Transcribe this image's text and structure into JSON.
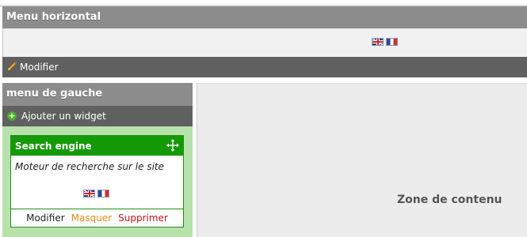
{
  "horizontal_menu": {
    "title": "Menu horizontal",
    "flags": [
      "english-flag-icon",
      "french-flag-icon"
    ],
    "edit_label": "Modifier"
  },
  "left_menu": {
    "title": "menu de gauche",
    "add_widget_label": "Ajouter un widget"
  },
  "widget": {
    "title": "Search engine",
    "description": "Moteur de recherche sur le site",
    "flags": [
      "english-flag-icon",
      "french-flag-icon"
    ],
    "actions": {
      "edit": "Modifier",
      "hide": "Masquer",
      "delete": "Supprimer"
    }
  },
  "content_zone": {
    "label": "Zone de contenu"
  },
  "colors": {
    "header_gray": "#8c8c8c",
    "toolbar_dark": "#606060",
    "widget_green": "#149a07",
    "left_bg_green": "#b7e2ac",
    "hide_orange": "#e88a12",
    "delete_red": "#c0141a"
  }
}
